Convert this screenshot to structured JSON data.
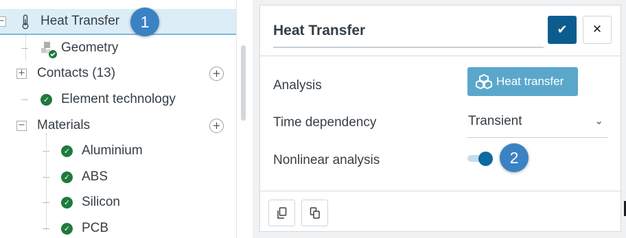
{
  "tree": {
    "items": [
      {
        "label": "Heat Transfer",
        "badge": "1"
      },
      {
        "label": "Geometry"
      },
      {
        "label": "Contacts (13)"
      },
      {
        "label": "Element technology"
      },
      {
        "label": "Materials"
      },
      {
        "label": "Aluminium"
      },
      {
        "label": "ABS"
      },
      {
        "label": "Silicon"
      },
      {
        "label": "PCB"
      }
    ],
    "expanders": {
      "root": "−",
      "contacts": "+",
      "materials": "−"
    },
    "add_symbol": "+"
  },
  "panel": {
    "title": "Heat Transfer",
    "confirm_symbol": "✔",
    "close_symbol": "✕",
    "fields": {
      "analysis_label": "Analysis",
      "analysis_value": "Heat transfer",
      "time_label": "Time dependency",
      "time_value": "Transient",
      "nonlinear_label": "Nonlinear analysis",
      "nonlinear_enabled": true
    },
    "toggle_badge": "2"
  },
  "colors": {
    "accent": "#0b5d8f",
    "button_light": "#5ba7cc",
    "check_green": "#1f7a3c",
    "badge_blue": "#3b82c4",
    "selection": "#dcedf7"
  }
}
